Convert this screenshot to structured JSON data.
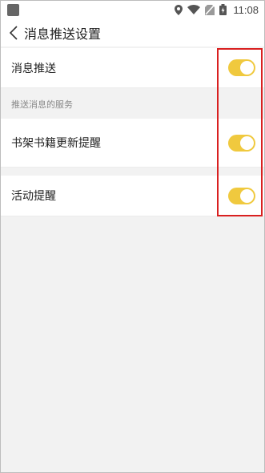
{
  "status_bar": {
    "time": "11:08",
    "icons": [
      "app-icon",
      "location-icon",
      "wifi-icon",
      "no-sim-icon",
      "battery-icon"
    ]
  },
  "header": {
    "back_icon": "chevron-left-icon",
    "title": "消息推送设置"
  },
  "settings": {
    "master": {
      "label": "消息推送",
      "enabled": true
    },
    "section_label": "推送消息的服务",
    "items": [
      {
        "label": "书架书籍更新提醒",
        "enabled": true
      },
      {
        "label": "活动提醒",
        "enabled": true
      }
    ]
  },
  "colors": {
    "toggle_on": "#f0c93e",
    "highlight": "#d92020",
    "background": "#f2f2f2"
  }
}
